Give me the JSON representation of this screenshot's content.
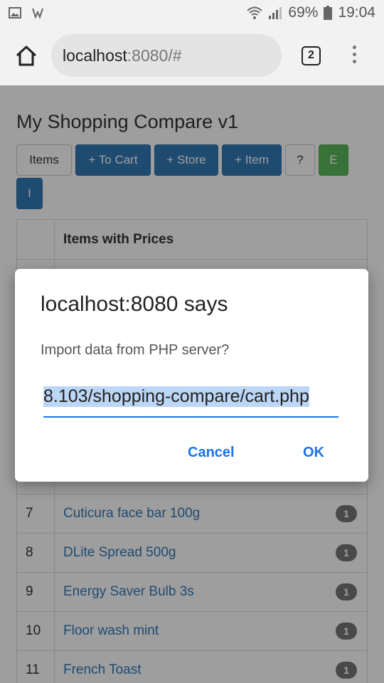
{
  "status_bar": {
    "battery": "69%",
    "time": "19:04"
  },
  "browser": {
    "url_host": "localhost",
    "url_rest": ":8080/#",
    "tab_count": "2"
  },
  "app": {
    "title": "My Shopping Compare v1",
    "buttons": {
      "items": "Items",
      "to_cart": "+ To Cart",
      "store": "+ Store",
      "item": "+ Item",
      "help": "?",
      "export": "E",
      "import": "I"
    }
  },
  "table": {
    "header": "Items with Prices",
    "rows": [
      {
        "num": "7",
        "name": "Cuticura face bar 100g",
        "count": "1"
      },
      {
        "num": "8",
        "name": "DLite Spread 500g",
        "count": "1"
      },
      {
        "num": "9",
        "name": "Energy Saver Bulb 3s",
        "count": "1"
      },
      {
        "num": "10",
        "name": "Floor wash mint",
        "count": "1"
      },
      {
        "num": "11",
        "name": "French Toast",
        "count": "1"
      }
    ]
  },
  "dialog": {
    "title": "localhost:8080 says",
    "message": "Import data from PHP server?",
    "input_value": "8.103/shopping-compare/cart.php",
    "cancel": "Cancel",
    "ok": "OK"
  },
  "colors": {
    "primary": "#337ab7",
    "success": "#5cb85c",
    "dialog_accent": "#1a73e8"
  }
}
